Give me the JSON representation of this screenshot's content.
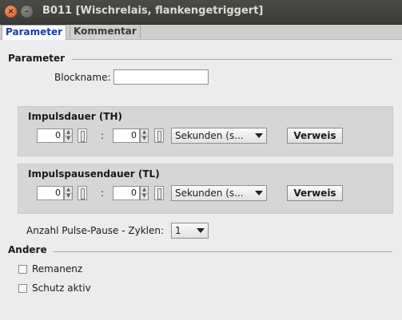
{
  "window": {
    "title": "B011 [Wischrelais, flankengetriggert]"
  },
  "tabs": [
    {
      "label": "Parameter",
      "active": true
    },
    {
      "label": "Kommentar",
      "active": false
    }
  ],
  "parameter_section": {
    "title": "Parameter",
    "blockname_label": "Blockname:",
    "blockname_value": ""
  },
  "impulsdauer": {
    "title": "Impulsdauer (TH)",
    "value1": "0",
    "separator": ":",
    "value2": "0",
    "unit": "Sekunden (s...",
    "button": "Verweis"
  },
  "impulspausendauer": {
    "title": "Impulspausendauer (TL)",
    "value1": "0",
    "separator": ":",
    "value2": "0",
    "unit": "Sekunden (s...",
    "button": "Verweis"
  },
  "cycles": {
    "label": "Anzahl Pulse-Pause - Zyklen:",
    "value": "1"
  },
  "andere_section": {
    "title": "Andere",
    "remanenz_label": "Remanenz",
    "remanenz_checked": false,
    "schutz_label": "Schutz aktiv",
    "schutz_checked": false
  }
}
